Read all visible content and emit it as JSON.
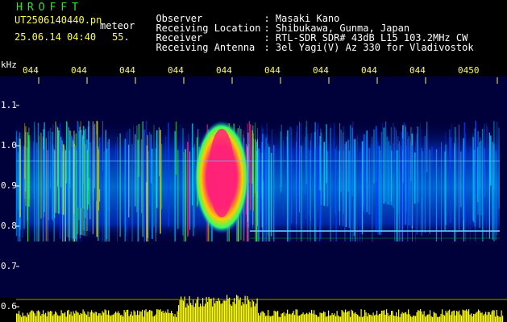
{
  "header": {
    "brand": "HROFFT",
    "filename": "UT2506140440.pn",
    "meteor_label": "meteor",
    "datetime": "25.06.14 04:40",
    "count": "55."
  },
  "station": {
    "rows": [
      {
        "label": "Observer",
        "value": ": Masaki Kano"
      },
      {
        "label": "Receiving Location",
        "value": ": Shibukawa, Gunma, Japan"
      },
      {
        "label": "Receiver",
        "value": ": RTL-SDR SDR# 43dB L15 103.2MHz CW"
      },
      {
        "label": "Receiving Antenna",
        "value": ": 3el Yagi(V) Az 330 for Vladivostok"
      }
    ]
  },
  "axes": {
    "unit": "kHz",
    "yticks": [
      "1.1",
      "1.0",
      "0.9",
      "0.8",
      "0.7",
      "0.6"
    ],
    "xticks": [
      "044",
      "044",
      "044",
      "044",
      "044",
      "044",
      "044",
      "044",
      "044",
      "0450"
    ]
  },
  "colors": {
    "background": "#000000",
    "low": "#00007a",
    "mid": "#00a8ff",
    "high": "#33ff33",
    "peak": "#ff2277",
    "amplitude": "#ffff00"
  }
}
